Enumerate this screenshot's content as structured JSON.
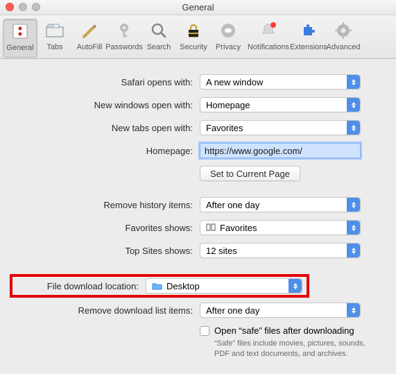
{
  "window": {
    "title": "General"
  },
  "toolbar": {
    "items": [
      {
        "id": "general",
        "label": "General"
      },
      {
        "id": "tabs",
        "label": "Tabs"
      },
      {
        "id": "autofill",
        "label": "AutoFill"
      },
      {
        "id": "passwords",
        "label": "Passwords"
      },
      {
        "id": "search",
        "label": "Search"
      },
      {
        "id": "security",
        "label": "Security"
      },
      {
        "id": "privacy",
        "label": "Privacy"
      },
      {
        "id": "notifications",
        "label": "Notifications"
      },
      {
        "id": "extensions",
        "label": "Extensions"
      },
      {
        "id": "advanced",
        "label": "Advanced"
      }
    ]
  },
  "form": {
    "safari_opens": {
      "label": "Safari opens with:",
      "value": "A new window"
    },
    "new_windows": {
      "label": "New windows open with:",
      "value": "Homepage"
    },
    "new_tabs": {
      "label": "New tabs open with:",
      "value": "Favorites"
    },
    "homepage": {
      "label": "Homepage:",
      "value": "https://www.google.com/"
    },
    "set_current": "Set to Current Page",
    "remove_history": {
      "label": "Remove history items:",
      "value": "After one day"
    },
    "favorites_shows": {
      "label": "Favorites shows:",
      "value": "Favorites"
    },
    "top_sites": {
      "label": "Top Sites shows:",
      "value": "12 sites"
    },
    "download_location": {
      "label": "File download location:",
      "value": "Desktop"
    },
    "remove_downloads": {
      "label": "Remove download list items:",
      "value": "After one day"
    },
    "open_safe": {
      "label": "Open “safe” files after downloading",
      "note": "“Safe” files include movies, pictures, sounds, PDF and text documents, and archives."
    }
  }
}
